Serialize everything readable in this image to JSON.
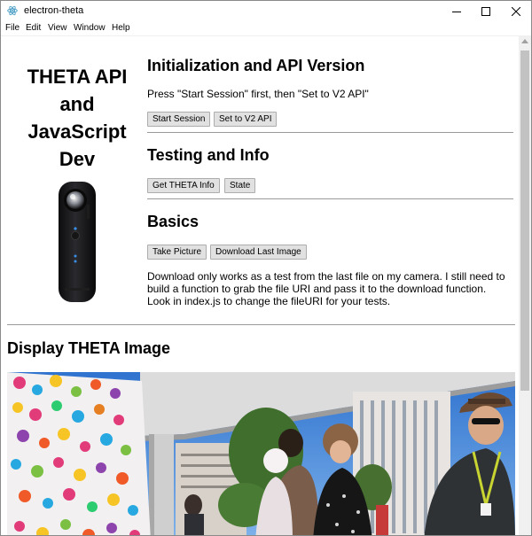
{
  "window": {
    "title": "electron-theta",
    "controls": {
      "minimize": "minimize-icon",
      "maximize": "maximize-icon",
      "close": "close-icon"
    }
  },
  "menu": {
    "items": [
      {
        "label": "File"
      },
      {
        "label": "Edit"
      },
      {
        "label": "View"
      },
      {
        "label": "Window"
      },
      {
        "label": "Help"
      }
    ]
  },
  "sidebar": {
    "title_lines": [
      "THETA API",
      "and",
      "JavaScript",
      "Dev"
    ]
  },
  "sections": {
    "init": {
      "heading": "Initialization and API Version",
      "instruction": "Press \"Start Session\" first, then \"Set to V2 API\"",
      "buttons": [
        "Start Session",
        "Set to V2 API"
      ]
    },
    "testing": {
      "heading": "Testing and Info",
      "buttons": [
        "Get THETA Info",
        "State"
      ]
    },
    "basics": {
      "heading": "Basics",
      "buttons": [
        "Take Picture",
        "Download Last Image"
      ],
      "note_lines": [
        "Download only works as a test from the last file on my camera. I still need to",
        "build a function to grab the file URI and pass it to the download function.",
        "Look in index.js to change the fileURI for your tests."
      ]
    },
    "display": {
      "heading": "Display THETA Image"
    }
  },
  "colors": {
    "button_bg": "#e1e1e1",
    "button_border": "#adadad",
    "rule": "#9a9a9a",
    "sky": "#3f86d8"
  }
}
